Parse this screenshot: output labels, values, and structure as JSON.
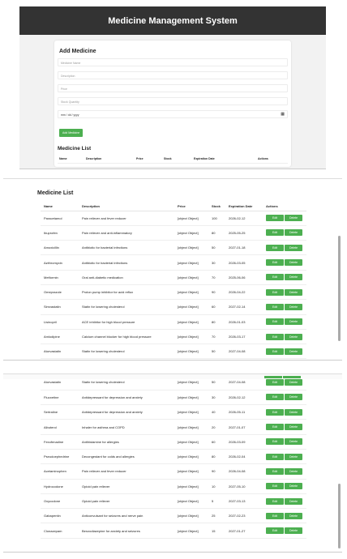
{
  "header": {
    "title": "Medicine Management System"
  },
  "form": {
    "title": "Add Medicine",
    "name_placeholder": "Medicine Name",
    "desc_placeholder": "Description",
    "price_placeholder": "Price",
    "stock_placeholder": "Stock Quantity",
    "date_placeholder": "mm / dd / yyyy",
    "add_button": "Add Medicine"
  },
  "list": {
    "title": "Medicine List",
    "columns": [
      "Name",
      "Description",
      "Price",
      "Stock",
      "Expiration Date",
      "Actions"
    ],
    "edit_label": "Edit",
    "delete_label": "Delete"
  },
  "page1_rows": [
    [
      "Paracetamol",
      "Pain reliever and fever reducer",
      "[object Object]",
      "100",
      "2026-02-12"
    ],
    [
      "Ibuprofen",
      "Pain reliever and anti-inflammatory",
      "[object Object]",
      "80",
      "2025-05-25"
    ],
    [
      "Amoxicillin",
      "Antibiotic for bacterial infections",
      "[object Object]",
      "50",
      "2027-01-18"
    ],
    [
      "Azithromycin",
      "Antibiotic for bacterial infections",
      "[object Object]",
      "30",
      "2026-03-05"
    ],
    [
      "Metformin",
      "Oral anti-diabetic medication",
      "[object Object]",
      "70",
      "2025-06-06"
    ],
    [
      "Omeprazole",
      "Proton pump inhibitor for acid reflux",
      "[object Object]",
      "90",
      "2026-04-22"
    ],
    [
      "Simvastatin",
      "Statin for lowering cholesterol",
      "[object Object]",
      "60",
      "2027-02-14"
    ],
    [
      "Lisinopril",
      "ACE inhibitor for high blood pressure",
      "[object Object]",
      "80",
      "2026-01-03"
    ],
    [
      "Amlodipine",
      "Calcium channel blocker for high blood pressure",
      "[object Object]",
      "70",
      "2026-03-17"
    ],
    [
      "Atorvastatin",
      "Statin for lowering cholesterol",
      "[object Object]",
      "50",
      "2027-04-08"
    ]
  ],
  "page2_rows": [
    [
      "Atorvastatin",
      "Statin for lowering cholesterol",
      "[object Object]",
      "50",
      "2027-04-08"
    ],
    [
      "Fluoxetine",
      "Antidepressant for depression and anxiety",
      "[object Object]",
      "30",
      "2026-02-12"
    ],
    [
      "Sertraline",
      "Antidepressant for depression and anxiety",
      "[object Object]",
      "40",
      "2026-05-11"
    ],
    [
      "Albuterol",
      "Inhaler for asthma and COPD",
      "[object Object]",
      "20",
      "2027-01-07"
    ],
    [
      "Fexofenadine",
      "Antihistamine for allergies",
      "[object Object]",
      "60",
      "2026-03-09"
    ],
    [
      "Pseudoephedrine",
      "Decongestant for colds and allergies",
      "[object Object]",
      "80",
      "2026-02-04"
    ],
    [
      "Acetaminophen",
      "Pain reliever and fever reducer",
      "[object Object]",
      "90",
      "2026-04-08"
    ],
    [
      "Hydrocodone",
      "Opioid pain reliever",
      "[object Object]",
      "10",
      "2027-05-10"
    ],
    [
      "Oxycodone",
      "Opioid pain reliever",
      "[object Object]",
      "5",
      "2027-03-13"
    ],
    [
      "Gabapentin",
      "Anticonvulsant for seizures and nerve pain",
      "[object Object]",
      "25",
      "2027-02-23"
    ],
    [
      "Clonazepam",
      "Benzodiazepine for anxiety and seizures",
      "[object Object]",
      "15",
      "2027-01-27"
    ]
  ],
  "colors": {
    "header_bg": "#333333",
    "button_green": "#4caf50"
  }
}
